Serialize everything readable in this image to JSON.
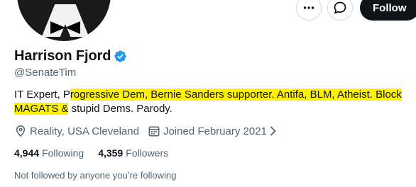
{
  "profile": {
    "name": "Harrison Fjord",
    "handle": "@SenateTim",
    "bio_parts": [
      {
        "text": "IT Expert, P",
        "highlight": false
      },
      {
        "text": "rogressive Dem, Bernie Sanders supporter. Antifa, BLM, Atheist. Block MAGATS &",
        "highlight": true
      },
      {
        "text": " stupid Dems. Parody.",
        "highlight": false
      }
    ],
    "location": "Reality, USA Cleveland",
    "joined": "Joined February 2021"
  },
  "actions": {
    "more_icon": "more-icon",
    "message_icon": "message-icon",
    "follow_label": "Follow"
  },
  "stats": {
    "following_count": "4,944",
    "following_label": "Following",
    "followers_count": "4,359",
    "followers_label": "Followers"
  },
  "followed_note": "Not followed by anyone you’re following",
  "colors": {
    "text": "#0f1419",
    "muted": "#536471",
    "verified": "#1d9bf0",
    "highlight": "#fff200",
    "follow_bg": "#0f1419"
  }
}
